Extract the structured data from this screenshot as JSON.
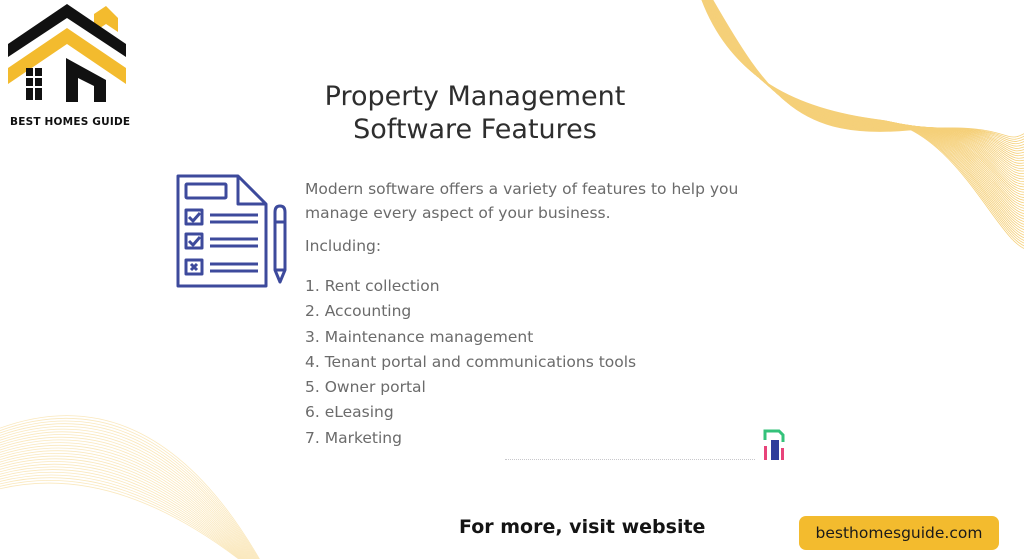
{
  "brand": {
    "logo_text": "BEST HOMES GUIDE",
    "colors": {
      "accent_yellow": "#f3bb2e",
      "logo_black": "#111111",
      "icon_blue": "#3d4a9c",
      "wave_yellow": "#f2c14e"
    }
  },
  "card": {
    "title_line1": "Property Management",
    "title_line2": "Software Features",
    "icon": "checklist-document-with-pencil-icon",
    "intro": "Modern software offers a variety of features to help you manage every aspect of your business.",
    "including_label": "Including:",
    "features": [
      "1. Rent collection",
      "2. Accounting",
      "3. Maintenance management",
      "4. Tenant portal and communications tools",
      "5. Owner portal",
      "6. eLeasing",
      "7. Marketing"
    ],
    "source_mark_icon": "brand-mark-icon"
  },
  "footer": {
    "cta_text": "For more, visit website",
    "website_button": "besthomesguide.com"
  }
}
